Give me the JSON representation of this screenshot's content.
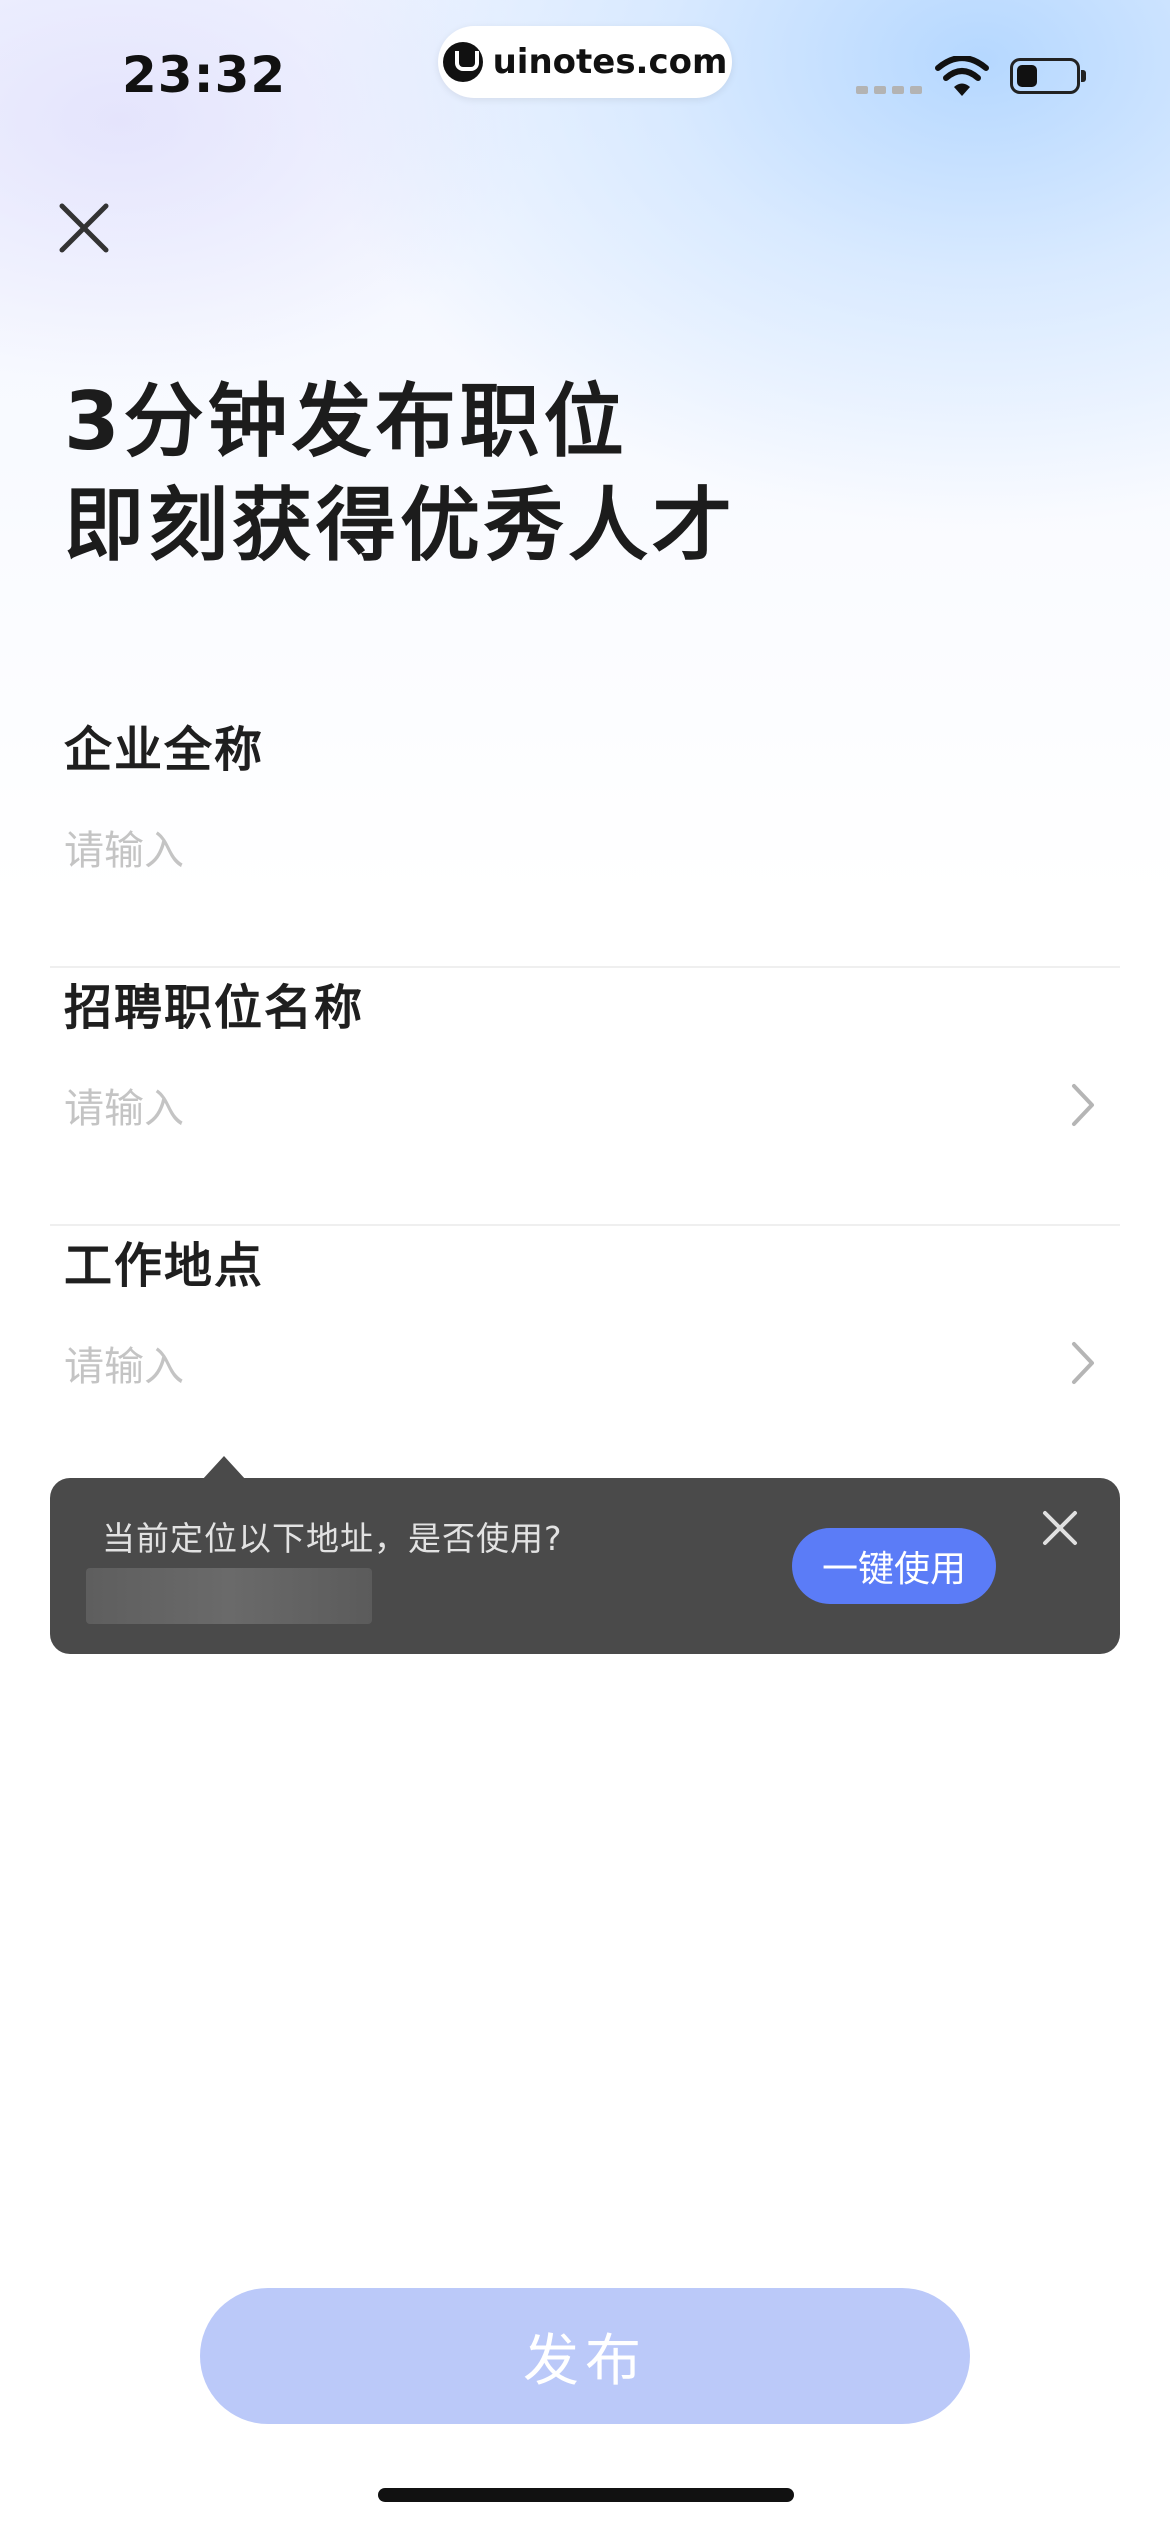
{
  "status_bar": {
    "time": "23:32",
    "url": "uinotes.com",
    "battery_level": 0.35
  },
  "headline": {
    "line1": "3分钟发布职位",
    "line2": "即刻获得优秀人才"
  },
  "form": {
    "company": {
      "label": "企业全称",
      "placeholder": "请输入",
      "value": ""
    },
    "position": {
      "label": "招聘职位名称",
      "placeholder": "请输入",
      "value": ""
    },
    "location": {
      "label": "工作地点",
      "placeholder": "请输入",
      "value": ""
    }
  },
  "location_tip": {
    "message": "当前定位以下地址，是否使用?",
    "use_label": "一键使用"
  },
  "publish": {
    "label": "发布"
  },
  "colors": {
    "primary": "#5b7cf7",
    "primary_disabled": "#bbc9f9",
    "tooltip_bg": "#4a4a4a"
  }
}
